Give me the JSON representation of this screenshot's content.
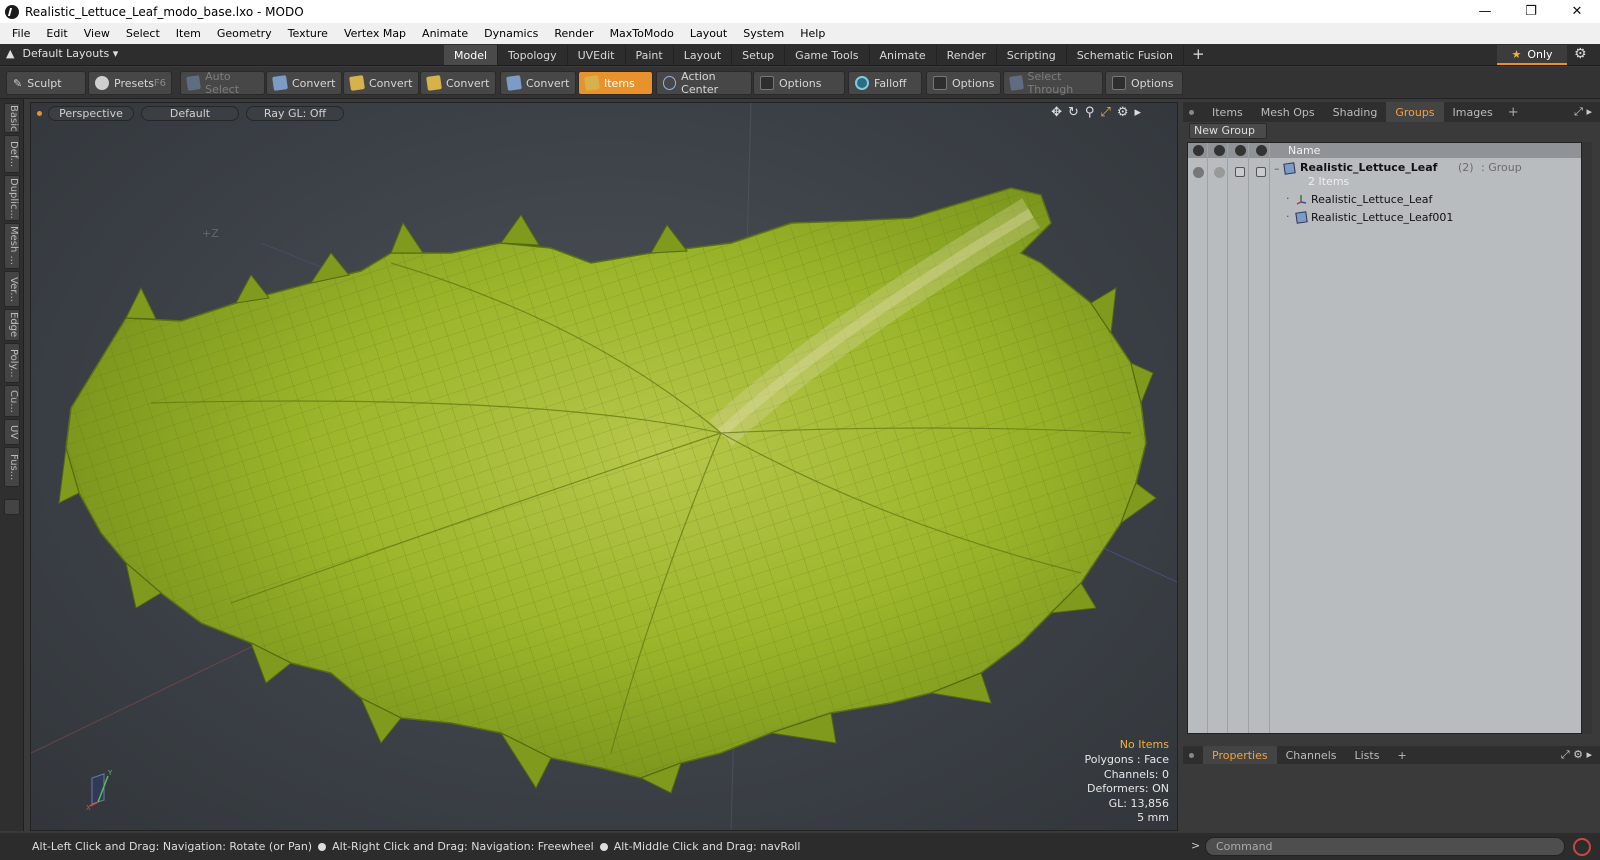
{
  "window": {
    "title": "Realistic_Lettuce_Leaf_modo_base.lxo - MODO"
  },
  "menu": [
    "File",
    "Edit",
    "View",
    "Select",
    "Item",
    "Geometry",
    "Texture",
    "Vertex Map",
    "Animate",
    "Dynamics",
    "Render",
    "MaxToModo",
    "Layout",
    "System",
    "Help"
  ],
  "layouts": {
    "label": "Default Layouts ▾"
  },
  "tabs": [
    "Model",
    "Topology",
    "UVEdit",
    "Paint",
    "Layout",
    "Setup",
    "Game Tools",
    "Animate",
    "Render",
    "Scripting",
    "Schematic Fusion"
  ],
  "only_label": "Only",
  "toolbar": {
    "sculpt": "Sculpt",
    "presets": "Presets",
    "presets_key": "F6",
    "auto_select": "Auto Select",
    "convert1": "Convert",
    "convert2": "Convert",
    "convert3": "Convert",
    "convert4": "Convert",
    "items": "Items",
    "action_center": "Action Center",
    "options1": "Options",
    "falloff": "Falloff",
    "options2": "Options",
    "select_through": "Select Through",
    "options3": "Options"
  },
  "left_tabs": [
    "Basic",
    "Def...",
    "Duplic...",
    "Mesh ...",
    "Ver...",
    "Edge",
    "Poly...",
    "Cu...",
    "UV",
    "Fus..."
  ],
  "viewport": {
    "view": "Perspective",
    "shading": "Default",
    "raygl": "Ray GL: Off",
    "axis_label": "+Z",
    "info": {
      "no_items": "No Items",
      "polygons": "Polygons : Face",
      "channels": "Channels: 0",
      "deformers": "Deformers: ON",
      "gl": "GL: 13,856",
      "scale": "5 mm"
    }
  },
  "right_panel": {
    "tabs": [
      "Items",
      "Mesh Ops",
      "Shading",
      "Groups",
      "Images"
    ],
    "active_tab": "Groups",
    "new_group": "New Group",
    "column_name": "Name",
    "group": {
      "name": "Realistic_Lettuce_Leaf",
      "count": "(2)",
      "type": ": Group",
      "subtitle": "2 Items"
    },
    "children": [
      "Realistic_Lettuce_Leaf",
      "Realistic_Lettuce_Leaf001"
    ]
  },
  "bottom_panel": {
    "tabs": [
      "Properties",
      "Channels",
      "Lists"
    ]
  },
  "status": {
    "hint1": "Alt-Left Click and Drag: Navigation: Rotate (or Pan)",
    "hint2": "Alt-Right Click and Drag: Navigation: Freewheel",
    "hint3": "Alt-Middle Click and Drag: navRoll"
  },
  "command": {
    "placeholder": "Command"
  },
  "colors": {
    "accent": "#e8922d",
    "leaf": "#9bb52a",
    "leaf_dark": "#6f8a18"
  }
}
